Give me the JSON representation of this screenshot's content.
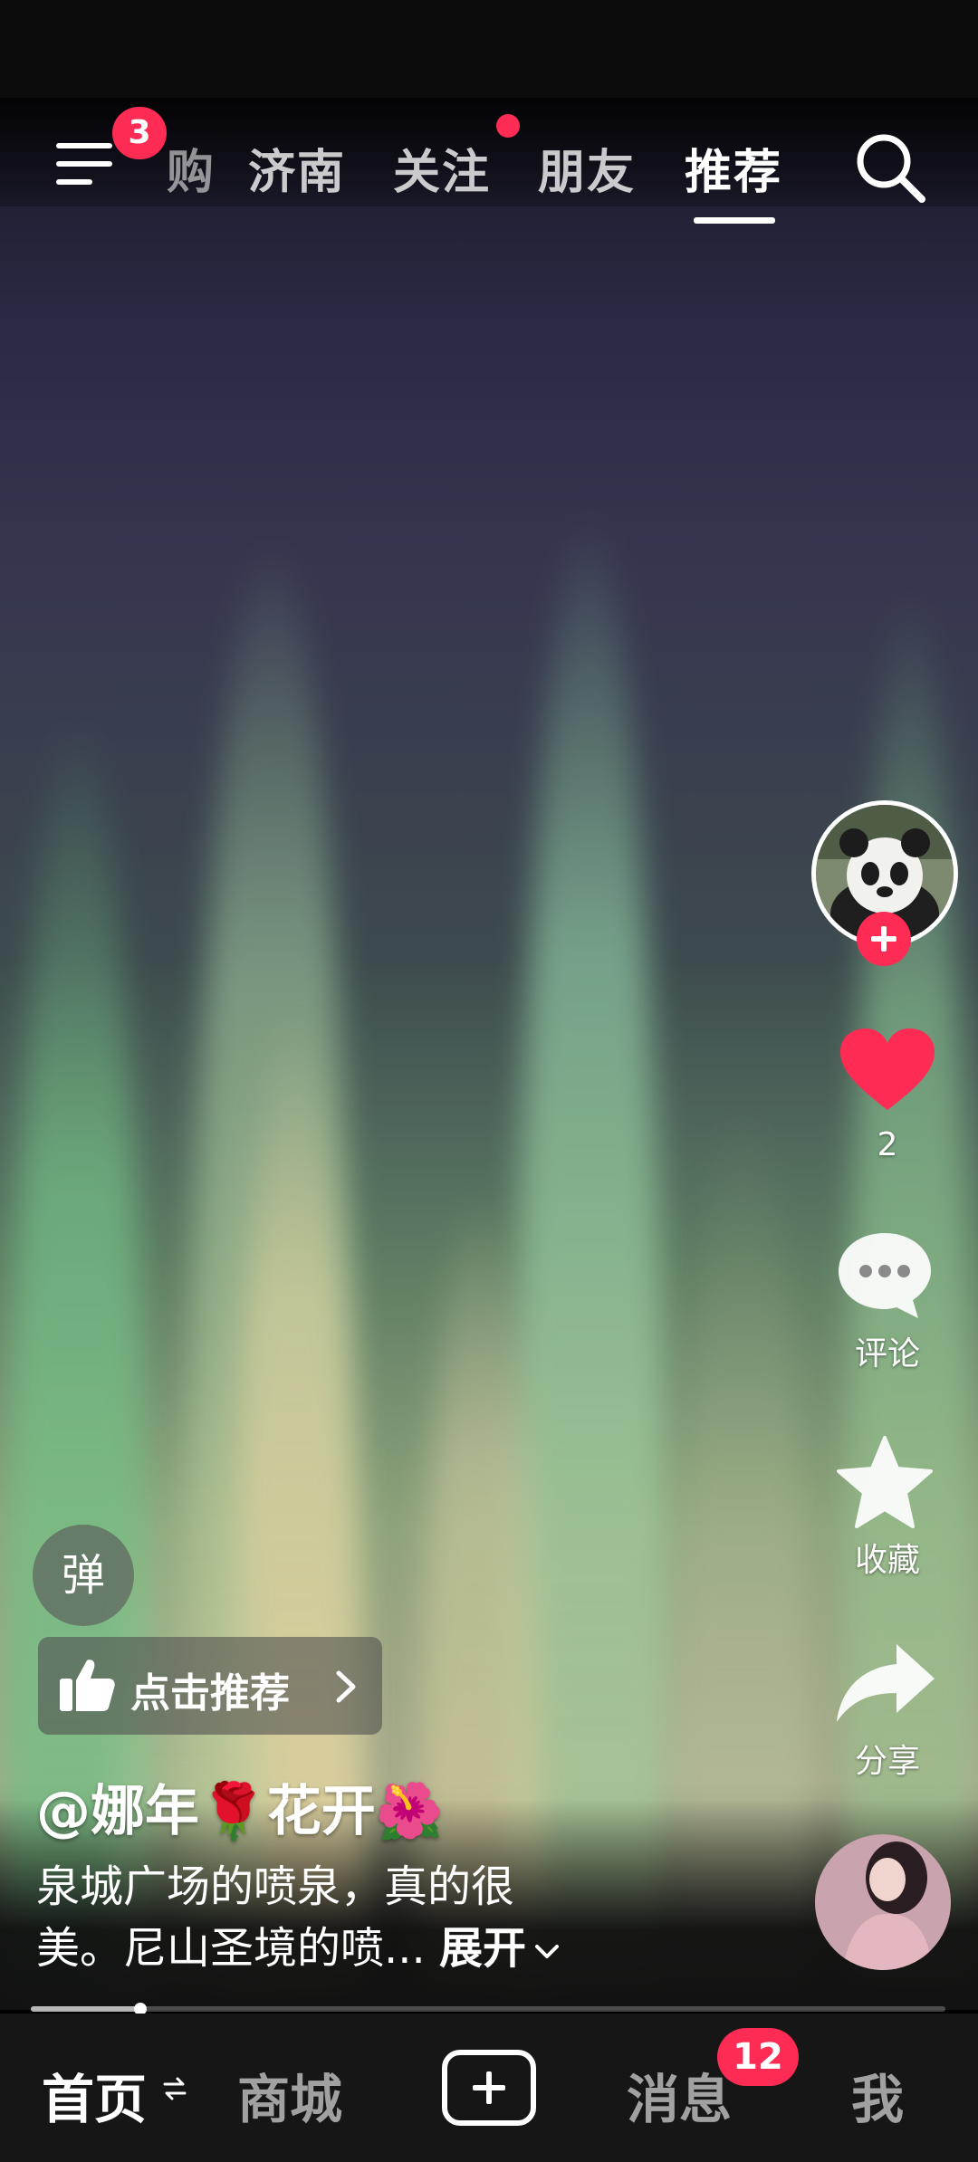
{
  "top_nav": {
    "menu_badge": "3",
    "tabs": [
      {
        "label": "购"
      },
      {
        "label": "济南"
      },
      {
        "label": "关注"
      },
      {
        "label": "朋友"
      },
      {
        "label": "推荐"
      }
    ],
    "active_tab": "推荐"
  },
  "side_actions": {
    "like_count": "2",
    "comment_label": "评论",
    "favorite_label": "收藏",
    "share_label": "分享"
  },
  "overlay": {
    "danmaku_label": "弹",
    "recommend_label": "点击推荐"
  },
  "post": {
    "username": "@娜年🌹花开🌺",
    "description_line1": "泉城广场的喷泉，真的很",
    "description_line2": "美。尼山圣境的喷...",
    "expand_label": "展开"
  },
  "progress": {
    "value": 0.12
  },
  "bottom_tabs": {
    "home": "首页",
    "mall": "商城",
    "messages": "消息",
    "messages_badge": "12",
    "me": "我"
  },
  "colors": {
    "accent": "#fe2c55",
    "tabbar": "#161616"
  }
}
